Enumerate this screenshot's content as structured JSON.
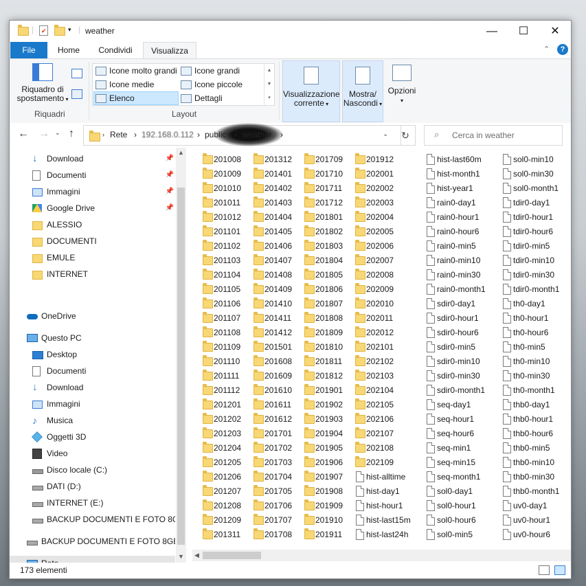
{
  "window": {
    "title": "weather"
  },
  "title_buttons": {
    "minimize": "—",
    "maximize": "☐",
    "close": "✕"
  },
  "ribbon_tabs": [
    "File",
    "Home",
    "Condividi",
    "Visualizza"
  ],
  "ribbon": {
    "riquadri": {
      "label": "Riquadro di spostamento",
      "group": "Riquadri"
    },
    "layout": {
      "group": "Layout",
      "options": [
        "Icone molto grandi",
        "Icone grandi",
        "Icone medie",
        "Icone piccole",
        "Elenco",
        "Dettagli"
      ],
      "selected": "Elenco"
    },
    "vis_corrente": "Visualizzazione corrente",
    "mostra": "Mostra/ Nascondi",
    "opzioni": "Opzioni"
  },
  "address": {
    "crumbs": [
      "Rete",
      "192.168.0.112",
      "public",
      "weather"
    ]
  },
  "search": {
    "placeholder": "Cerca in weather"
  },
  "nav_pane": {
    "quick": [
      {
        "label": "Download",
        "icon": "download-arrow-icon",
        "pinned": true
      },
      {
        "label": "Documenti",
        "icon": "document-icon",
        "pinned": true
      },
      {
        "label": "Immagini",
        "icon": "image-icon",
        "pinned": true
      },
      {
        "label": "Google Drive",
        "icon": "google-drive-icon",
        "pinned": true
      },
      {
        "label": "ALESSIO",
        "icon": "folder-icon",
        "pinned": false
      },
      {
        "label": "DOCUMENTI",
        "icon": "folder-icon",
        "pinned": false
      },
      {
        "label": "EMULE",
        "icon": "folder-icon",
        "pinned": false
      },
      {
        "label": "INTERNET",
        "icon": "folder-icon",
        "pinned": false
      }
    ],
    "onedrive": "OneDrive",
    "thispc": {
      "label": "Questo PC",
      "items": [
        {
          "label": "Desktop",
          "icon": "desktop-icon"
        },
        {
          "label": "Documenti",
          "icon": "document-icon"
        },
        {
          "label": "Download",
          "icon": "download-arrow-icon"
        },
        {
          "label": "Immagini",
          "icon": "image-icon"
        },
        {
          "label": "Musica",
          "icon": "music-icon"
        },
        {
          "label": "Oggetti 3D",
          "icon": "cube-3d-icon"
        },
        {
          "label": "Video",
          "icon": "video-icon"
        },
        {
          "label": "Disco locale (C:)",
          "icon": "drive-c-icon"
        },
        {
          "label": "DATI (D:)",
          "icon": "drive-icon"
        },
        {
          "label": "INTERNET (E:)",
          "icon": "drive-icon"
        },
        {
          "label": "BACKUP DOCUMENTI E FOTO 8GB (",
          "icon": "drive-icon"
        }
      ]
    },
    "external": "BACKUP DOCUMENTI E FOTO 8GB (H",
    "network": "Rete"
  },
  "files": [
    {
      "name": "201008",
      "type": "folder"
    },
    {
      "name": "201009",
      "type": "folder"
    },
    {
      "name": "201010",
      "type": "folder"
    },
    {
      "name": "201011",
      "type": "folder"
    },
    {
      "name": "201012",
      "type": "folder"
    },
    {
      "name": "201101",
      "type": "folder"
    },
    {
      "name": "201102",
      "type": "folder"
    },
    {
      "name": "201103",
      "type": "folder"
    },
    {
      "name": "201104",
      "type": "folder"
    },
    {
      "name": "201105",
      "type": "folder"
    },
    {
      "name": "201106",
      "type": "folder"
    },
    {
      "name": "201107",
      "type": "folder"
    },
    {
      "name": "201108",
      "type": "folder"
    },
    {
      "name": "201109",
      "type": "folder"
    },
    {
      "name": "201110",
      "type": "folder"
    },
    {
      "name": "201111",
      "type": "folder"
    },
    {
      "name": "201112",
      "type": "folder"
    },
    {
      "name": "201201",
      "type": "folder"
    },
    {
      "name": "201202",
      "type": "folder"
    },
    {
      "name": "201203",
      "type": "folder"
    },
    {
      "name": "201204",
      "type": "folder"
    },
    {
      "name": "201205",
      "type": "folder"
    },
    {
      "name": "201206",
      "type": "folder"
    },
    {
      "name": "201207",
      "type": "folder"
    },
    {
      "name": "201208",
      "type": "folder"
    },
    {
      "name": "201209",
      "type": "folder"
    },
    {
      "name": "201311",
      "type": "folder"
    },
    {
      "name": "201312",
      "type": "folder"
    },
    {
      "name": "201401",
      "type": "folder"
    },
    {
      "name": "201402",
      "type": "folder"
    },
    {
      "name": "201403",
      "type": "folder"
    },
    {
      "name": "201404",
      "type": "folder"
    },
    {
      "name": "201405",
      "type": "folder"
    },
    {
      "name": "201406",
      "type": "folder"
    },
    {
      "name": "201407",
      "type": "folder"
    },
    {
      "name": "201408",
      "type": "folder"
    },
    {
      "name": "201409",
      "type": "folder"
    },
    {
      "name": "201410",
      "type": "folder"
    },
    {
      "name": "201411",
      "type": "folder"
    },
    {
      "name": "201412",
      "type": "folder"
    },
    {
      "name": "201501",
      "type": "folder"
    },
    {
      "name": "201608",
      "type": "folder"
    },
    {
      "name": "201609",
      "type": "folder"
    },
    {
      "name": "201610",
      "type": "folder"
    },
    {
      "name": "201611",
      "type": "folder"
    },
    {
      "name": "201612",
      "type": "folder"
    },
    {
      "name": "201701",
      "type": "folder"
    },
    {
      "name": "201702",
      "type": "folder"
    },
    {
      "name": "201703",
      "type": "folder"
    },
    {
      "name": "201704",
      "type": "folder"
    },
    {
      "name": "201705",
      "type": "folder"
    },
    {
      "name": "201706",
      "type": "folder"
    },
    {
      "name": "201707",
      "type": "folder"
    },
    {
      "name": "201708",
      "type": "folder"
    },
    {
      "name": "201709",
      "type": "folder"
    },
    {
      "name": "201710",
      "type": "folder"
    },
    {
      "name": "201711",
      "type": "folder"
    },
    {
      "name": "201712",
      "type": "folder"
    },
    {
      "name": "201801",
      "type": "folder"
    },
    {
      "name": "201802",
      "type": "folder"
    },
    {
      "name": "201803",
      "type": "folder"
    },
    {
      "name": "201804",
      "type": "folder"
    },
    {
      "name": "201805",
      "type": "folder"
    },
    {
      "name": "201806",
      "type": "folder"
    },
    {
      "name": "201807",
      "type": "folder"
    },
    {
      "name": "201808",
      "type": "folder"
    },
    {
      "name": "201809",
      "type": "folder"
    },
    {
      "name": "201810",
      "type": "folder"
    },
    {
      "name": "201811",
      "type": "folder"
    },
    {
      "name": "201812",
      "type": "folder"
    },
    {
      "name": "201901",
      "type": "folder"
    },
    {
      "name": "201902",
      "type": "folder"
    },
    {
      "name": "201903",
      "type": "folder"
    },
    {
      "name": "201904",
      "type": "folder"
    },
    {
      "name": "201905",
      "type": "folder"
    },
    {
      "name": "201906",
      "type": "folder"
    },
    {
      "name": "201907",
      "type": "folder"
    },
    {
      "name": "201908",
      "type": "folder"
    },
    {
      "name": "201909",
      "type": "folder"
    },
    {
      "name": "201910",
      "type": "folder"
    },
    {
      "name": "201911",
      "type": "folder"
    },
    {
      "name": "201912",
      "type": "folder"
    },
    {
      "name": "202001",
      "type": "folder"
    },
    {
      "name": "202002",
      "type": "folder"
    },
    {
      "name": "202003",
      "type": "folder"
    },
    {
      "name": "202004",
      "type": "folder"
    },
    {
      "name": "202005",
      "type": "folder"
    },
    {
      "name": "202006",
      "type": "folder"
    },
    {
      "name": "202007",
      "type": "folder"
    },
    {
      "name": "202008",
      "type": "folder"
    },
    {
      "name": "202009",
      "type": "folder"
    },
    {
      "name": "202010",
      "type": "folder"
    },
    {
      "name": "202011",
      "type": "folder"
    },
    {
      "name": "202012",
      "type": "folder"
    },
    {
      "name": "202101",
      "type": "folder"
    },
    {
      "name": "202102",
      "type": "folder"
    },
    {
      "name": "202103",
      "type": "folder"
    },
    {
      "name": "202104",
      "type": "folder"
    },
    {
      "name": "202105",
      "type": "folder"
    },
    {
      "name": "202106",
      "type": "folder"
    },
    {
      "name": "202107",
      "type": "folder"
    },
    {
      "name": "202108",
      "type": "folder"
    },
    {
      "name": "202109",
      "type": "folder"
    },
    {
      "name": "hist-alltime",
      "type": "file"
    },
    {
      "name": "hist-day1",
      "type": "file"
    },
    {
      "name": "hist-hour1",
      "type": "file"
    },
    {
      "name": "hist-last15m",
      "type": "file"
    },
    {
      "name": "hist-last24h",
      "type": "file"
    },
    {
      "name": "hist-last60m",
      "type": "file"
    },
    {
      "name": "hist-month1",
      "type": "file"
    },
    {
      "name": "hist-year1",
      "type": "file"
    },
    {
      "name": "rain0-day1",
      "type": "file"
    },
    {
      "name": "rain0-hour1",
      "type": "file"
    },
    {
      "name": "rain0-hour6",
      "type": "file"
    },
    {
      "name": "rain0-min5",
      "type": "file"
    },
    {
      "name": "rain0-min10",
      "type": "file"
    },
    {
      "name": "rain0-min30",
      "type": "file"
    },
    {
      "name": "rain0-month1",
      "type": "file"
    },
    {
      "name": "sdir0-day1",
      "type": "file"
    },
    {
      "name": "sdir0-hour1",
      "type": "file"
    },
    {
      "name": "sdir0-hour6",
      "type": "file"
    },
    {
      "name": "sdir0-min5",
      "type": "file"
    },
    {
      "name": "sdir0-min10",
      "type": "file"
    },
    {
      "name": "sdir0-min30",
      "type": "file"
    },
    {
      "name": "sdir0-month1",
      "type": "file"
    },
    {
      "name": "seq-day1",
      "type": "file"
    },
    {
      "name": "seq-hour1",
      "type": "file"
    },
    {
      "name": "seq-hour6",
      "type": "file"
    },
    {
      "name": "seq-min1",
      "type": "file"
    },
    {
      "name": "seq-min15",
      "type": "file"
    },
    {
      "name": "seq-month1",
      "type": "file"
    },
    {
      "name": "sol0-day1",
      "type": "file"
    },
    {
      "name": "sol0-hour1",
      "type": "file"
    },
    {
      "name": "sol0-hour6",
      "type": "file"
    },
    {
      "name": "sol0-min5",
      "type": "file"
    },
    {
      "name": "sol0-min10",
      "type": "file"
    },
    {
      "name": "sol0-min30",
      "type": "file"
    },
    {
      "name": "sol0-month1",
      "type": "file"
    },
    {
      "name": "tdir0-day1",
      "type": "file"
    },
    {
      "name": "tdir0-hour1",
      "type": "file"
    },
    {
      "name": "tdir0-hour6",
      "type": "file"
    },
    {
      "name": "tdir0-min5",
      "type": "file"
    },
    {
      "name": "tdir0-min10",
      "type": "file"
    },
    {
      "name": "tdir0-min30",
      "type": "file"
    },
    {
      "name": "tdir0-month1",
      "type": "file"
    },
    {
      "name": "th0-day1",
      "type": "file"
    },
    {
      "name": "th0-hour1",
      "type": "file"
    },
    {
      "name": "th0-hour6",
      "type": "file"
    },
    {
      "name": "th0-min5",
      "type": "file"
    },
    {
      "name": "th0-min10",
      "type": "file"
    },
    {
      "name": "th0-min30",
      "type": "file"
    },
    {
      "name": "th0-month1",
      "type": "file"
    },
    {
      "name": "thb0-day1",
      "type": "file"
    },
    {
      "name": "thb0-hour1",
      "type": "file"
    },
    {
      "name": "thb0-hour6",
      "type": "file"
    },
    {
      "name": "thb0-min5",
      "type": "file"
    },
    {
      "name": "thb0-min10",
      "type": "file"
    },
    {
      "name": "thb0-min30",
      "type": "file"
    },
    {
      "name": "thb0-month1",
      "type": "file"
    },
    {
      "name": "uv0-day1",
      "type": "file"
    },
    {
      "name": "uv0-hour1",
      "type": "file"
    },
    {
      "name": "uv0-hour6",
      "type": "file"
    }
  ],
  "status": {
    "count": "173 elementi"
  },
  "colors": {
    "accent": "#1979ca",
    "folder": "#f8d775",
    "selected": "#cce8ff"
  }
}
